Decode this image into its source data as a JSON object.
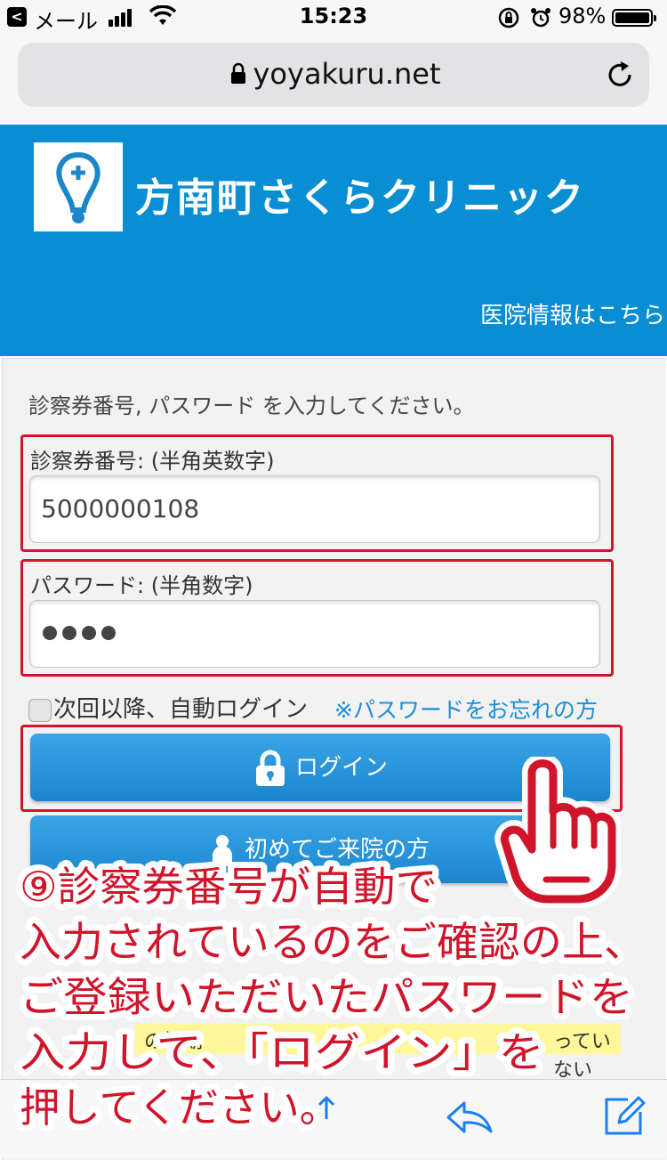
{
  "status_bar": {
    "back_glyph": "<",
    "carrier": "メール",
    "time": "15:23",
    "battery_percent": "98%"
  },
  "url_bar": {
    "domain": "yoyakuru.net"
  },
  "clinic": {
    "name": "方南町さくらクリニック",
    "info_link": "医院情報はこちら"
  },
  "login_form": {
    "instructions": "診察券番号, パスワード を入力してください。",
    "card_number_label": "診察券番号: (半角英数字)",
    "card_number_value": "5000000108",
    "password_label": "パスワード: (半角数字)",
    "password_length": 4,
    "auto_login_label": "次回以降、自動ログイン",
    "forgot_password_link": "※パスワードをお忘れの方",
    "login_button": "ログイン",
    "first_visit_button": "初めてご来院の方"
  },
  "notice_fragment": {
    "left": "の初期",
    "right": "っていない"
  },
  "annotation": {
    "lines": [
      "⑨診察券番号が自動で",
      "入力されているのをご確認の上、",
      "ご登録いただいたパスワードを",
      "入力して、「ログイン」を",
      "押してください。"
    ]
  },
  "colors": {
    "header_blue": "#0a8ed3",
    "button_blue": "#2a95dc",
    "highlight_red": "#d0152b",
    "link_blue": "#1a8fd6"
  }
}
